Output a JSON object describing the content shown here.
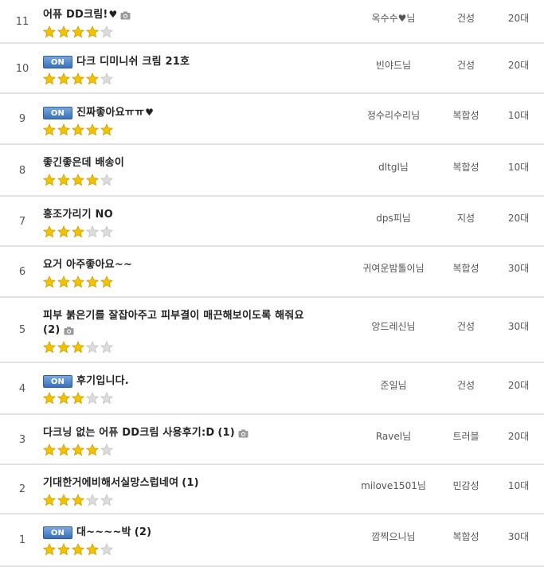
{
  "reviews": [
    {
      "num": "11",
      "on": false,
      "title": "어퓨 DD크림!",
      "heart": true,
      "suffix": "",
      "camera": true,
      "rating": 4,
      "author": "옥수수♥님",
      "skin": "건성",
      "age": "20대"
    },
    {
      "num": "10",
      "on": true,
      "title": "다크 디미니쉬 크림 21호",
      "heart": false,
      "suffix": "",
      "camera": false,
      "rating": 4,
      "author": "빈야드님",
      "skin": "건성",
      "age": "20대"
    },
    {
      "num": "9",
      "on": true,
      "title": "진짜좋아요ㅠㅠ",
      "heart": true,
      "suffix": "",
      "camera": false,
      "rating": 5,
      "author": "정수리수리님",
      "skin": "복합성",
      "age": "10대"
    },
    {
      "num": "8",
      "on": false,
      "title": "좋긴좋은데 배송이",
      "heart": false,
      "suffix": "",
      "camera": false,
      "rating": 4,
      "author": "dltgl님",
      "skin": "복합성",
      "age": "10대"
    },
    {
      "num": "7",
      "on": false,
      "title": "홍조가리기 NO",
      "heart": false,
      "suffix": "",
      "camera": false,
      "rating": 3,
      "author": "dps피님",
      "skin": "지성",
      "age": "20대"
    },
    {
      "num": "6",
      "on": false,
      "title": "요거 아주좋아요~~",
      "heart": false,
      "suffix": "",
      "camera": false,
      "rating": 5,
      "author": "귀여운밤톨이님",
      "skin": "복합성",
      "age": "30대"
    },
    {
      "num": "5",
      "on": false,
      "title": "피부 붉은기를 잘잡아주고 피부결이 매끈해보이도록 해줘요",
      "heart": false,
      "suffix": "(2)",
      "camera": true,
      "rating": 3,
      "author": "앙드레신님",
      "skin": "건성",
      "age": "30대"
    },
    {
      "num": "4",
      "on": true,
      "title": "후기입니다.",
      "heart": false,
      "suffix": "",
      "camera": false,
      "rating": 3,
      "author": "준일님",
      "skin": "건성",
      "age": "20대"
    },
    {
      "num": "3",
      "on": false,
      "title": "다크닝 없는 어퓨 DD크림 사용후기:D",
      "heart": false,
      "suffix": "(1)",
      "camera": true,
      "rating": 4,
      "author": "Ravel님",
      "skin": "트러블",
      "age": "20대"
    },
    {
      "num": "2",
      "on": false,
      "title": "기대한거에비해서실망스럽네여",
      "heart": false,
      "suffix": "(1)",
      "camera": false,
      "rating": 3,
      "author": "milove1501님",
      "skin": "민감성",
      "age": "10대"
    },
    {
      "num": "1",
      "on": true,
      "title": "대~~~~박",
      "heart": false,
      "suffix": "(2)",
      "camera": false,
      "rating": 4,
      "author": "깜찍으니님",
      "skin": "복합성",
      "age": "30대"
    }
  ],
  "badge_label": "ON",
  "heart_glyph": "♥",
  "max_rating": 5,
  "colors": {
    "star_on": "#f2c200",
    "star_off": "#dcdcdc",
    "badge": "#3b6fb6"
  }
}
